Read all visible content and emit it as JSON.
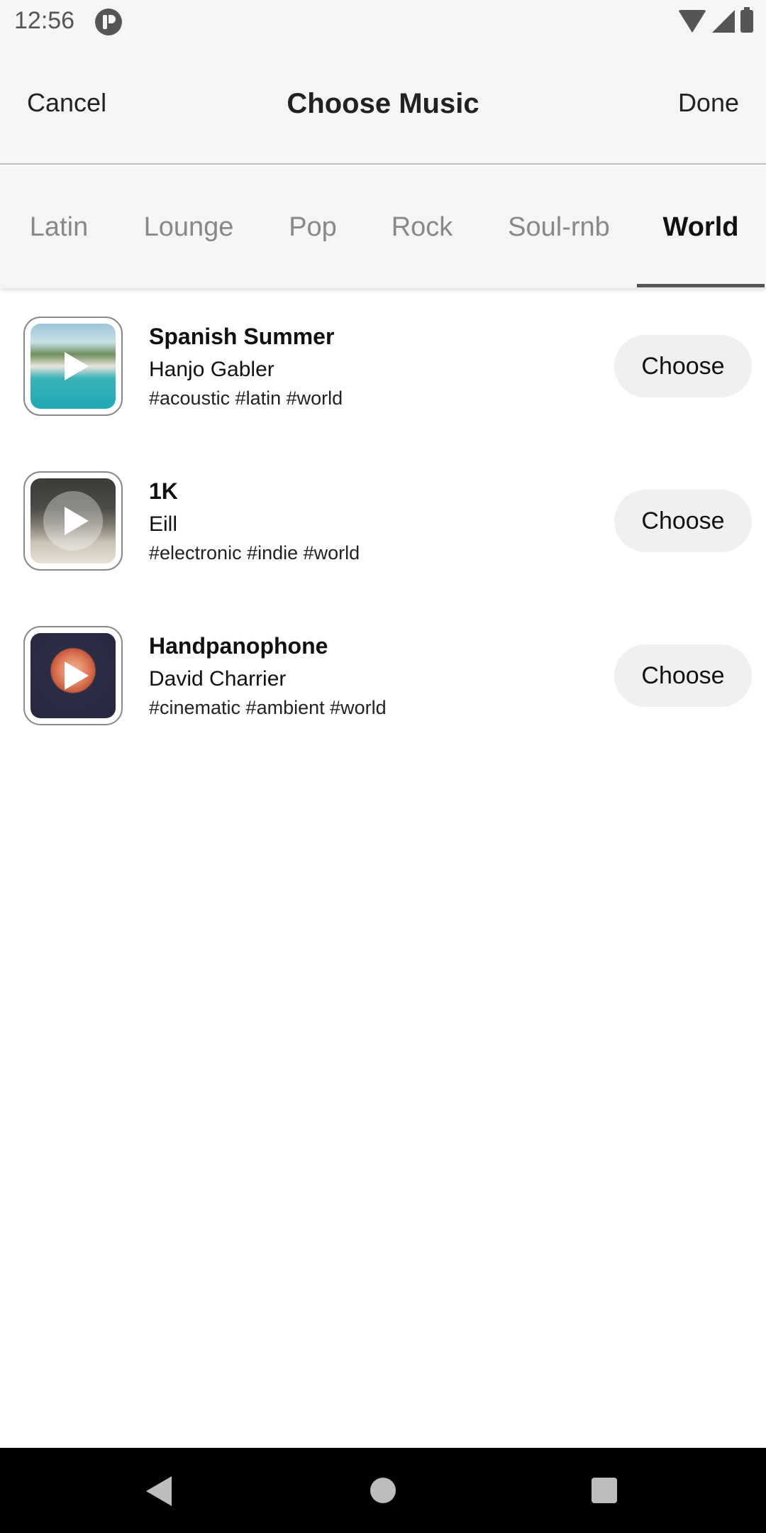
{
  "status_bar": {
    "time": "12:56"
  },
  "header": {
    "cancel_label": "Cancel",
    "title": "Choose Music",
    "done_label": "Done"
  },
  "tabs": [
    {
      "label": "Latin",
      "active": false
    },
    {
      "label": "Lounge",
      "active": false
    },
    {
      "label": "Pop",
      "active": false
    },
    {
      "label": "Rock",
      "active": false
    },
    {
      "label": "Soul-rnb",
      "active": false
    },
    {
      "label": "World",
      "active": true
    }
  ],
  "tracks": [
    {
      "title": "Spanish Summer",
      "artist": "Hanjo Gabler",
      "tags": "#acoustic #latin #world",
      "choose_label": "Choose",
      "art_icon": "beach-cover"
    },
    {
      "title": "1K",
      "artist": "Eill",
      "tags": "#electronic #indie #world",
      "choose_label": "Choose",
      "art_icon": "eill-cover"
    },
    {
      "title": "Handpanophone",
      "artist": "David Charrier",
      "tags": "#cinematic #ambient #world",
      "choose_label": "Choose",
      "art_icon": "flower-cover"
    }
  ],
  "colors": {
    "header_bg": "#f5f5f5",
    "tab_inactive": "#888888",
    "tab_active": "#111111",
    "button_bg": "#f0f0f0"
  }
}
